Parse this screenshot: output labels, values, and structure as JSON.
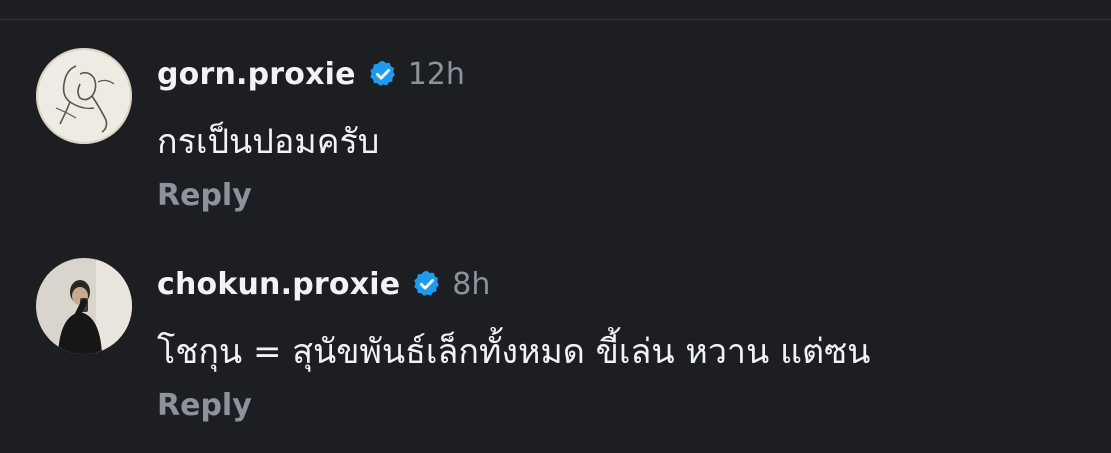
{
  "comments": [
    {
      "username": "gorn.proxie",
      "verified": true,
      "time": "12h",
      "text": "กรเป็นปอมครับ",
      "reply_label": "Reply",
      "avatar_icon": "sketch-drawing-avatar"
    },
    {
      "username": "chokun.proxie",
      "verified": true,
      "time": "8h",
      "text": "โชกุน = สุนัขพันธ์เล็กทั้งหมด ขี้เล่น หวาน แต่ซน",
      "reply_label": "Reply",
      "avatar_icon": "mirror-selfie-avatar"
    }
  ],
  "colors": {
    "background": "#1c1e22",
    "text_primary": "#f2f3f5",
    "text_secondary": "#8d929b",
    "verified_badge": "#1d9bf0"
  }
}
